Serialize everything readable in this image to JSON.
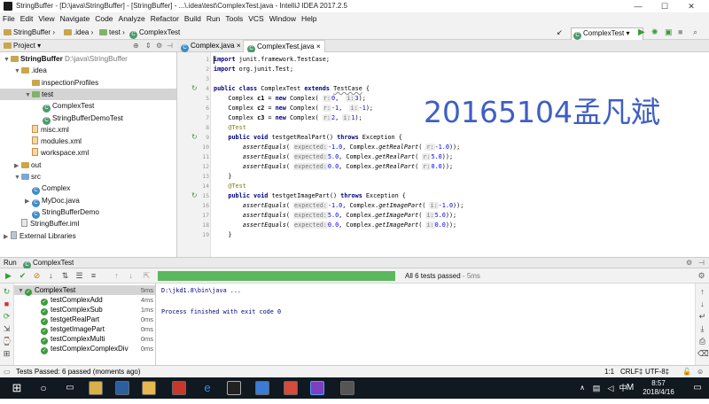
{
  "window": {
    "title": "StringBuffer - [D:\\java\\StringBuffer] - [StringBuffer] - ...\\.idea\\test\\ComplexTest.java - IntelliJ IDEA 2017.2.5",
    "controls": [
      "—",
      "☐",
      "✕"
    ]
  },
  "menu": [
    "File",
    "Edit",
    "View",
    "Navigate",
    "Code",
    "Analyze",
    "Refactor",
    "Build",
    "Run",
    "Tools",
    "VCS",
    "Window",
    "Help"
  ],
  "breadcrumbs": [
    "StringBuffer",
    ".idea",
    "test",
    "ComplexTest"
  ],
  "run_config": "ComplexTest",
  "project_panel": {
    "label": "Project",
    "tree": [
      {
        "label": "StringBuffer",
        "hint": "D:\\java\\StringBuffer",
        "indent": 0,
        "arrow": "▼",
        "icon": "folder",
        "bold": true
      },
      {
        "label": ".idea",
        "indent": 1,
        "arrow": "▼",
        "icon": "folder"
      },
      {
        "label": "inspectionProfiles",
        "indent": 2,
        "arrow": "",
        "icon": "folder"
      },
      {
        "label": "test",
        "indent": 2,
        "arrow": "▼",
        "icon": "folder-green",
        "selected": true
      },
      {
        "label": "ComplexTest",
        "indent": 3,
        "arrow": "",
        "icon": "class-test"
      },
      {
        "label": "StringBufferDemoTest",
        "indent": 3,
        "arrow": "",
        "icon": "class-test"
      },
      {
        "label": "misc.xml",
        "indent": 2,
        "arrow": "",
        "icon": "xml"
      },
      {
        "label": "modules.xml",
        "indent": 2,
        "arrow": "",
        "icon": "xml"
      },
      {
        "label": "workspace.xml",
        "indent": 2,
        "arrow": "",
        "icon": "xml"
      },
      {
        "label": "out",
        "indent": 1,
        "arrow": "▶",
        "icon": "folder"
      },
      {
        "label": "src",
        "indent": 1,
        "arrow": "▼",
        "icon": "folder-blue"
      },
      {
        "label": "Complex",
        "indent": 2,
        "arrow": "",
        "icon": "class"
      },
      {
        "label": "MyDoc.java",
        "indent": 2,
        "arrow": "▶",
        "icon": "class"
      },
      {
        "label": "StringBufferDemo",
        "indent": 2,
        "arrow": "",
        "icon": "class"
      },
      {
        "label": "StringBuffer.iml",
        "indent": 1,
        "arrow": "",
        "icon": "file"
      },
      {
        "label": "External Libraries",
        "indent": 0,
        "arrow": "▶",
        "icon": "lib"
      }
    ]
  },
  "editor_tabs": [
    {
      "label": "Complex.java",
      "active": false
    },
    {
      "label": "ComplexTest.java",
      "active": true
    }
  ],
  "code_lines": [
    {
      "n": "1",
      "html": "<span class='kw'>import</span> junit.framework.TestCase;"
    },
    {
      "n": "2",
      "html": "<span class='kw'>import</span> org.junit.Test;"
    },
    {
      "n": "3",
      "html": ""
    },
    {
      "n": "4",
      "html": "<span class='kw'>public class</span> ComplexTest <span class='kw'>extends</span> <span class='tc'>TestCase</span> {"
    },
    {
      "n": "5",
      "html": "    Complex <b>c1</b> = <span class='kw'>new</span> Complex( <span class='hint'>r:</span><span class='num'>0</span>,  <span class='hint'>i:</span><span class='num'>3</span>);"
    },
    {
      "n": "6",
      "html": "    Complex <b>c2</b> = <span class='kw'>new</span> Complex( <span class='hint'>r:</span><span class='num'>-1</span>,  <span class='hint'>i:</span><span class='num'>-1</span>);"
    },
    {
      "n": "7",
      "html": "    Complex <b>c3</b> = <span class='kw'>new</span> Complex( <span class='hint'>r:</span><span class='num'>2</span>, <span class='hint'>i:</span><span class='num'>1</span>);"
    },
    {
      "n": "8",
      "html": "    <span class='an'>@Test</span>"
    },
    {
      "n": "9",
      "html": "    <span class='kw'>public void</span> testgetRealPart() <span class='kw'>throws</span> Exception {"
    },
    {
      "n": "10",
      "html": "        <span class='it'>assertEquals</span>( <span class='hint'>expected:</span><span class='num'>-1.0</span>, Complex.<span class='it'>getRealPart</span>( <span class='hint'>r:</span><span class='num'>-1.0</span>));"
    },
    {
      "n": "11",
      "html": "        <span class='it'>assertEquals</span>( <span class='hint'>expected:</span><span class='num'>5.0</span>, Complex.<span class='it'>getRealPart</span>( <span class='hint'>r:</span><span class='num'>5.0</span>));"
    },
    {
      "n": "12",
      "html": "        <span class='it'>assertEquals</span>( <span class='hint'>expected:</span><span class='num'>0.0</span>, Complex.<span class='it'>getRealPart</span>( <span class='hint'>r:</span><span class='num'>0.0</span>));"
    },
    {
      "n": "13",
      "html": "    }"
    },
    {
      "n": "14",
      "html": "    <span class='an'>@Test</span>"
    },
    {
      "n": "15",
      "html": "    <span class='kw'>public void</span> testgetImagePart() <span class='kw'>throws</span> Exception {"
    },
    {
      "n": "16",
      "html": "        <span class='it'>assertEquals</span>( <span class='hint'>expected:</span><span class='num'>-1.0</span>, Complex.<span class='it'>getImagePart</span>( <span class='hint'>i:</span><span class='num'>-1.0</span>));"
    },
    {
      "n": "17",
      "html": "        <span class='it'>assertEquals</span>( <span class='hint'>expected:</span><span class='num'>5.0</span>, Complex.<span class='it'>getImagePart</span>( <span class='hint'>i:</span><span class='num'>5.0</span>));"
    },
    {
      "n": "18",
      "html": "        <span class='it'>assertEquals</span>( <span class='hint'>expected:</span><span class='num'>0.0</span>, Complex.<span class='it'>getImagePart</span>( <span class='hint'>i:</span><span class='num'>0.0</span>));"
    },
    {
      "n": "19",
      "html": "    }"
    }
  ],
  "watermark": "20165104孟凡斌",
  "run_panel": {
    "label": "Run",
    "config": "ComplexTest",
    "summary": "All 6 tests passed",
    "summary_time": " - 5ms",
    "root": {
      "label": "ComplexTest",
      "time": "5ms"
    },
    "tests": [
      {
        "label": "testComplexAdd",
        "time": "4ms"
      },
      {
        "label": "testComplexSub",
        "time": "1ms"
      },
      {
        "label": "testgetRealPart",
        "time": "0ms"
      },
      {
        "label": "testgetImagePart",
        "time": "0ms"
      },
      {
        "label": "testComplexMulti",
        "time": "0ms"
      },
      {
        "label": "testComplexComplexDiv",
        "time": "0ms"
      }
    ],
    "console": [
      "D:\\jkd1.8\\bin\\java ...",
      "",
      "Process finished with exit code 0"
    ]
  },
  "status": {
    "left": "Tests Passed: 6 passed (moments ago)",
    "position": "1:1",
    "line_sep": "CRLF‡",
    "encoding": "UTF-8‡"
  },
  "taskbar": {
    "time": "8:57",
    "date": "2018/4/16",
    "ime": "M",
    "lang": "中"
  }
}
